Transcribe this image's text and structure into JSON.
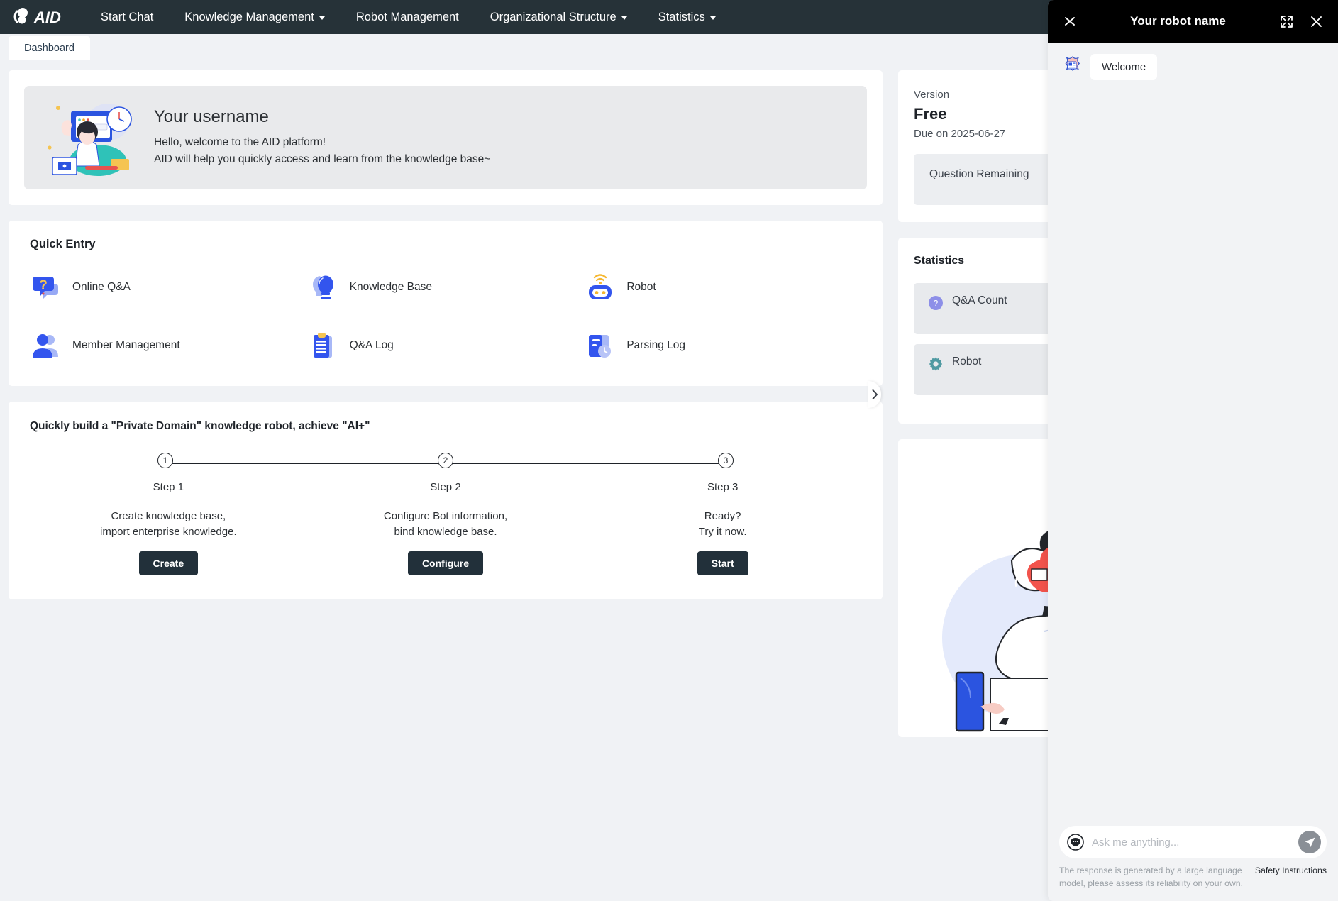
{
  "navbar": {
    "logo_text": "AID",
    "items": [
      {
        "label": "Start Chat",
        "has_caret": false
      },
      {
        "label": "Knowledge Management",
        "has_caret": true
      },
      {
        "label": "Robot Management",
        "has_caret": false
      },
      {
        "label": "Organizational Structure",
        "has_caret": true
      },
      {
        "label": "Statistics",
        "has_caret": true
      }
    ]
  },
  "tabs": {
    "dashboard": "Dashboard"
  },
  "welcome": {
    "username": "Your username",
    "line1": "Hello, welcome to the AID platform!",
    "line2": "AID will help you quickly access and learn from the knowledge base~"
  },
  "quick_entry": {
    "title": "Quick Entry",
    "items": [
      {
        "label": "Online Q&A",
        "icon": "question-bubble-icon"
      },
      {
        "label": "Knowledge Base",
        "icon": "lightbulb-icon"
      },
      {
        "label": "Robot",
        "icon": "robot-icon"
      },
      {
        "label": "Member Management",
        "icon": "members-icon"
      },
      {
        "label": "Q&A Log",
        "icon": "clipboard-icon"
      },
      {
        "label": "Parsing Log",
        "icon": "document-clock-icon"
      }
    ]
  },
  "steps_section": {
    "title": "Quickly build a \"Private Domain\" knowledge robot, achieve \"AI+\"",
    "steps": [
      {
        "number": "1",
        "name": "Step 1",
        "desc_line1": "Create knowledge base,",
        "desc_line2": "import enterprise knowledge.",
        "button": "Create"
      },
      {
        "number": "2",
        "name": "Step 2",
        "desc_line1": "Configure Bot information,",
        "desc_line2": "bind knowledge base.",
        "button": "Configure"
      },
      {
        "number": "3",
        "name": "Step 3",
        "desc_line1": "Ready?",
        "desc_line2": "Try it now.",
        "button": "Start"
      }
    ]
  },
  "version_card": {
    "label": "Version",
    "plan": "Free",
    "due": "Due on 2025-06-27",
    "metric_label": "Question Remaining"
  },
  "statistics_card": {
    "title": "Statistics",
    "rows": [
      {
        "label": "Q&A Count",
        "icon": "question-circle-icon"
      },
      {
        "label": "Robot",
        "icon": "gear-icon"
      }
    ]
  },
  "chat": {
    "title": "Your robot name",
    "collapse_icon": "collapse-chevrons-icon",
    "expand_icon": "fullscreen-icon",
    "close_icon": "close-icon",
    "messages": [
      {
        "sender": "bot",
        "text": "Welcome"
      }
    ],
    "input_placeholder": "Ask me anything...",
    "input_value": "",
    "emoji_icon": "emoji-icon",
    "send_icon": "send-icon",
    "disclaimer": "The response is generated by a large language model, please assess its reliability on your own.",
    "safety_link": "Safety Instructions"
  },
  "colors": {
    "navbar_bg": "#263238",
    "page_bg": "#f0f2f5",
    "accent_blue": "#3355dd",
    "button_dark": "#22303a",
    "chat_header_bg": "#000000"
  }
}
